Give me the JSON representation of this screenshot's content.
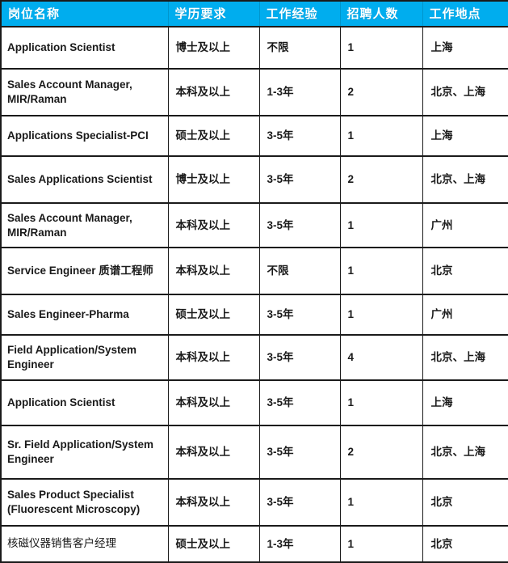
{
  "table": {
    "columns": [
      {
        "key": "title",
        "label": "岗位名称"
      },
      {
        "key": "education",
        "label": "学历要求"
      },
      {
        "key": "experience",
        "label": "工作经验"
      },
      {
        "key": "headcount",
        "label": "招聘人数"
      },
      {
        "key": "location",
        "label": "工作地点"
      }
    ],
    "header_bg": "#00ADEE",
    "header_text_color": "#FFFFFF",
    "border_color": "#1A1A1A",
    "body_bg": "#FFFFFF",
    "rows": [
      {
        "title": "Application Scientist",
        "education": "博士及以上",
        "experience": "不限",
        "headcount": "1",
        "location": "上海"
      },
      {
        "title": "Sales Account Manager, MIR/Raman",
        "education": "本科及以上",
        "experience": "1-3年",
        "headcount": "2",
        "location": "北京、上海"
      },
      {
        "title": "Applications Specialist-PCI",
        "education": "硕士及以上",
        "experience": "3-5年",
        "headcount": "1",
        "location": "上海"
      },
      {
        "title": "Sales Applications Scientist",
        "education": "博士及以上",
        "experience": "3-5年",
        "headcount": "2",
        "location": "北京、上海"
      },
      {
        "title": "Sales Account Manager, MIR/Raman",
        "education": "本科及以上",
        "experience": "3-5年",
        "headcount": "1",
        "location": "广州"
      },
      {
        "title": "Service Engineer 质谱工程师",
        "education": "本科及以上",
        "experience": "不限",
        "headcount": "1",
        "location": "北京"
      },
      {
        "title": "Sales Engineer-Pharma",
        "education": "硕士及以上",
        "experience": "3-5年",
        "headcount": "1",
        "location": "广州"
      },
      {
        "title": "Field Application/System Engineer",
        "education": "本科及以上",
        "experience": "3-5年",
        "headcount": "4",
        "location": "北京、上海"
      },
      {
        "title": "Application Scientist",
        "education": "本科及以上",
        "experience": "3-5年",
        "headcount": "1",
        "location": "上海"
      },
      {
        "title": "Sr. Field Application/System Engineer",
        "education": "本科及以上",
        "experience": "3-5年",
        "headcount": "2",
        "location": "北京、上海"
      },
      {
        "title": "Sales Product Specialist (Fluorescent Microscopy)",
        "education": "本科及以上",
        "experience": "3-5年",
        "headcount": "1",
        "location": "北京"
      },
      {
        "title": "核磁仪器销售客户经理",
        "education": "硕士及以上",
        "experience": "1-3年",
        "headcount": "1",
        "location": "北京"
      }
    ]
  }
}
